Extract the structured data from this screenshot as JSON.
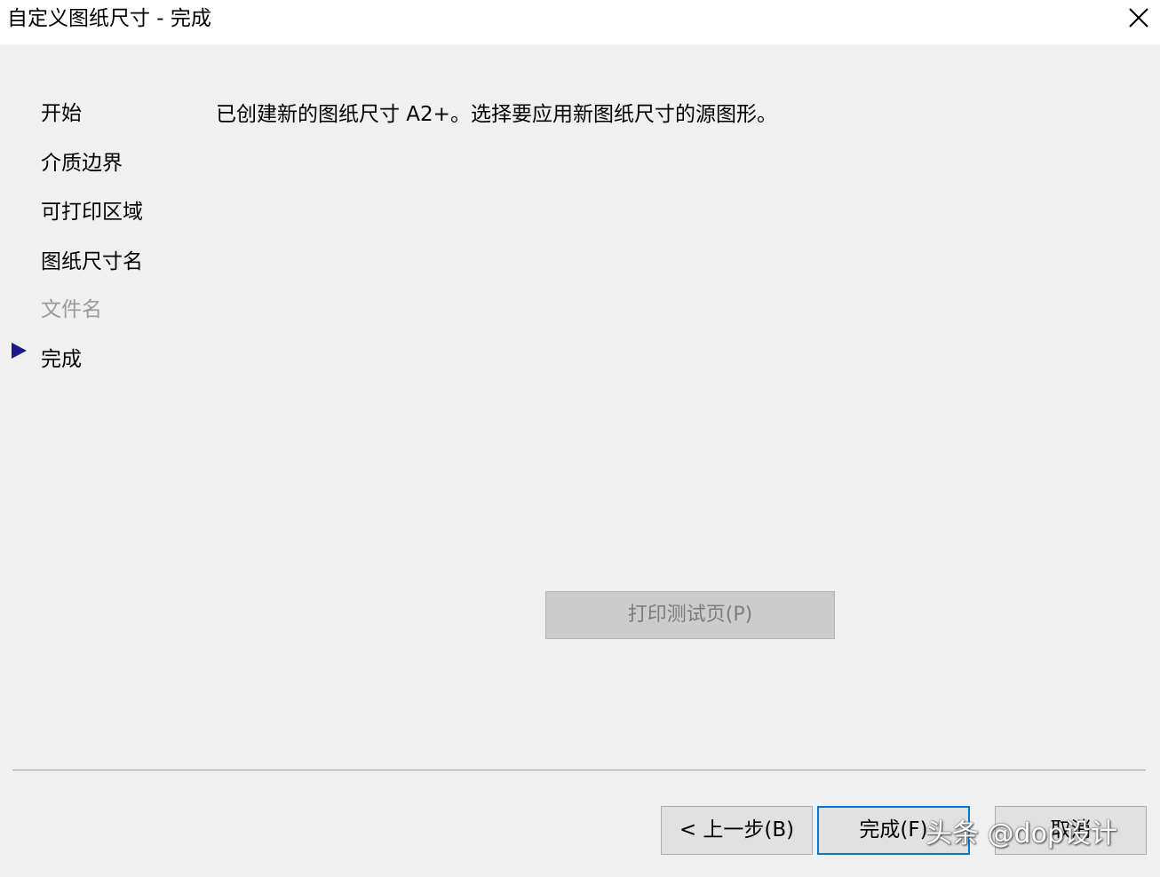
{
  "window": {
    "title": "自定义图纸尺寸 - 完成"
  },
  "steps": [
    {
      "label": "开始",
      "state": "normal"
    },
    {
      "label": "介质边界",
      "state": "normal"
    },
    {
      "label": "可打印区域",
      "state": "normal"
    },
    {
      "label": "图纸尺寸名",
      "state": "normal"
    },
    {
      "label": "文件名",
      "state": "disabled"
    },
    {
      "label": "完成",
      "state": "current"
    }
  ],
  "main": {
    "message": "已创建新的图纸尺寸 A2+。选择要应用新图纸尺寸的源图形。",
    "test_page_button": "打印测试页(P)",
    "test_page_enabled": false
  },
  "footer": {
    "back_label": "< 上一步(B)",
    "finish_label": "完成(F)",
    "cancel_label": "取消"
  },
  "watermark": "头条 @dop设计",
  "colors": {
    "accent": "#0078d7",
    "step_arrow": "#1a1a8c",
    "disabled_text": "#9a9a9a"
  },
  "icons": {
    "close": "close-icon",
    "current_step": "triangle-right-icon"
  }
}
